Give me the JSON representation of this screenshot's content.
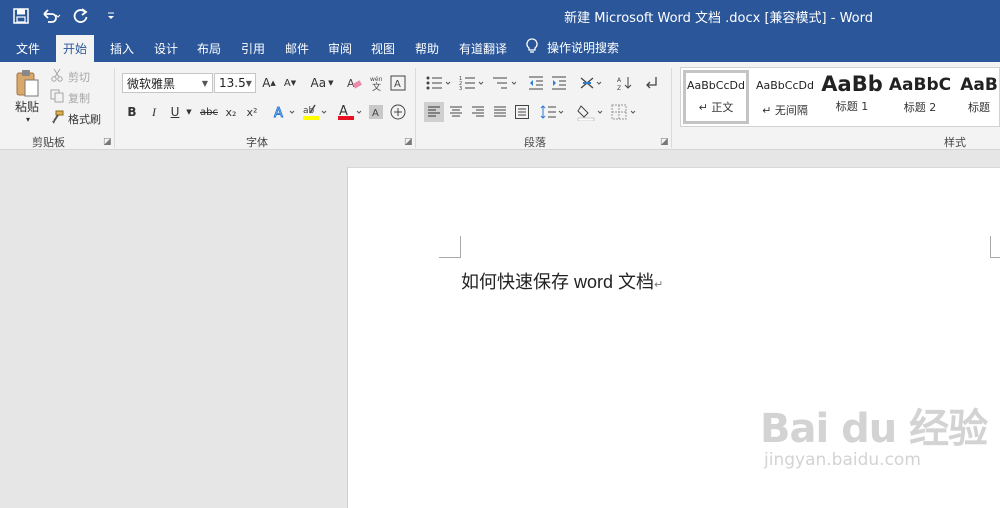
{
  "title_bar": {
    "document_title": "新建 Microsoft Word 文档 .docx [兼容模式]  -  Word",
    "quick_access": [
      {
        "icon": "save-icon"
      },
      {
        "icon": "undo-icon"
      },
      {
        "icon": "redo-icon"
      },
      {
        "icon": "customize-qat-icon"
      }
    ]
  },
  "tabs": [
    "文件",
    "开始",
    "插入",
    "设计",
    "布局",
    "引用",
    "邮件",
    "审阅",
    "视图",
    "帮助",
    "有道翻译"
  ],
  "active_tab": "开始",
  "tell_me": {
    "icon": "lightbulb-icon",
    "label": "操作说明搜索"
  },
  "clipboard": {
    "group_label": "剪贴板",
    "paste": "粘贴",
    "cut": "剪切",
    "copy": "复制",
    "format_painter": "格式刷"
  },
  "font": {
    "group_label": "字体",
    "font_name": "微软雅黑",
    "font_size": "13.5",
    "grow": "A",
    "shrink": "A",
    "change_case": "Aa",
    "bold": "B",
    "italic": "I",
    "underline": "U",
    "strikethrough": "abc",
    "subscript": "x₂",
    "superscript": "x²",
    "font_color": "A",
    "char_shading": "A",
    "enclose_char": "字"
  },
  "paragraph": {
    "group_label": "段落"
  },
  "styles": {
    "group_label": "样式",
    "items": [
      {
        "sample": "AaBbCcDd",
        "name": "↵ 正文"
      },
      {
        "sample": "AaBbCcDd",
        "name": "↵ 无间隔"
      },
      {
        "sample": "AaBb",
        "name": "标题 1"
      },
      {
        "sample": "AaBbC",
        "name": "标题 2"
      },
      {
        "sample": "AaB",
        "name": "标题"
      }
    ]
  },
  "document": {
    "text": "如何快速保存 word 文档",
    "paragraph_mark": "↵"
  },
  "watermark": {
    "main": "Bai du 经验",
    "sub": "jingyan.baidu.com"
  },
  "colors": {
    "title_bar": "#2b579a",
    "ribbon": "#f3f3f3",
    "canvas": "#e6e6e6",
    "highlight_yellow": "#ffff00",
    "font_red": "#e81123"
  }
}
